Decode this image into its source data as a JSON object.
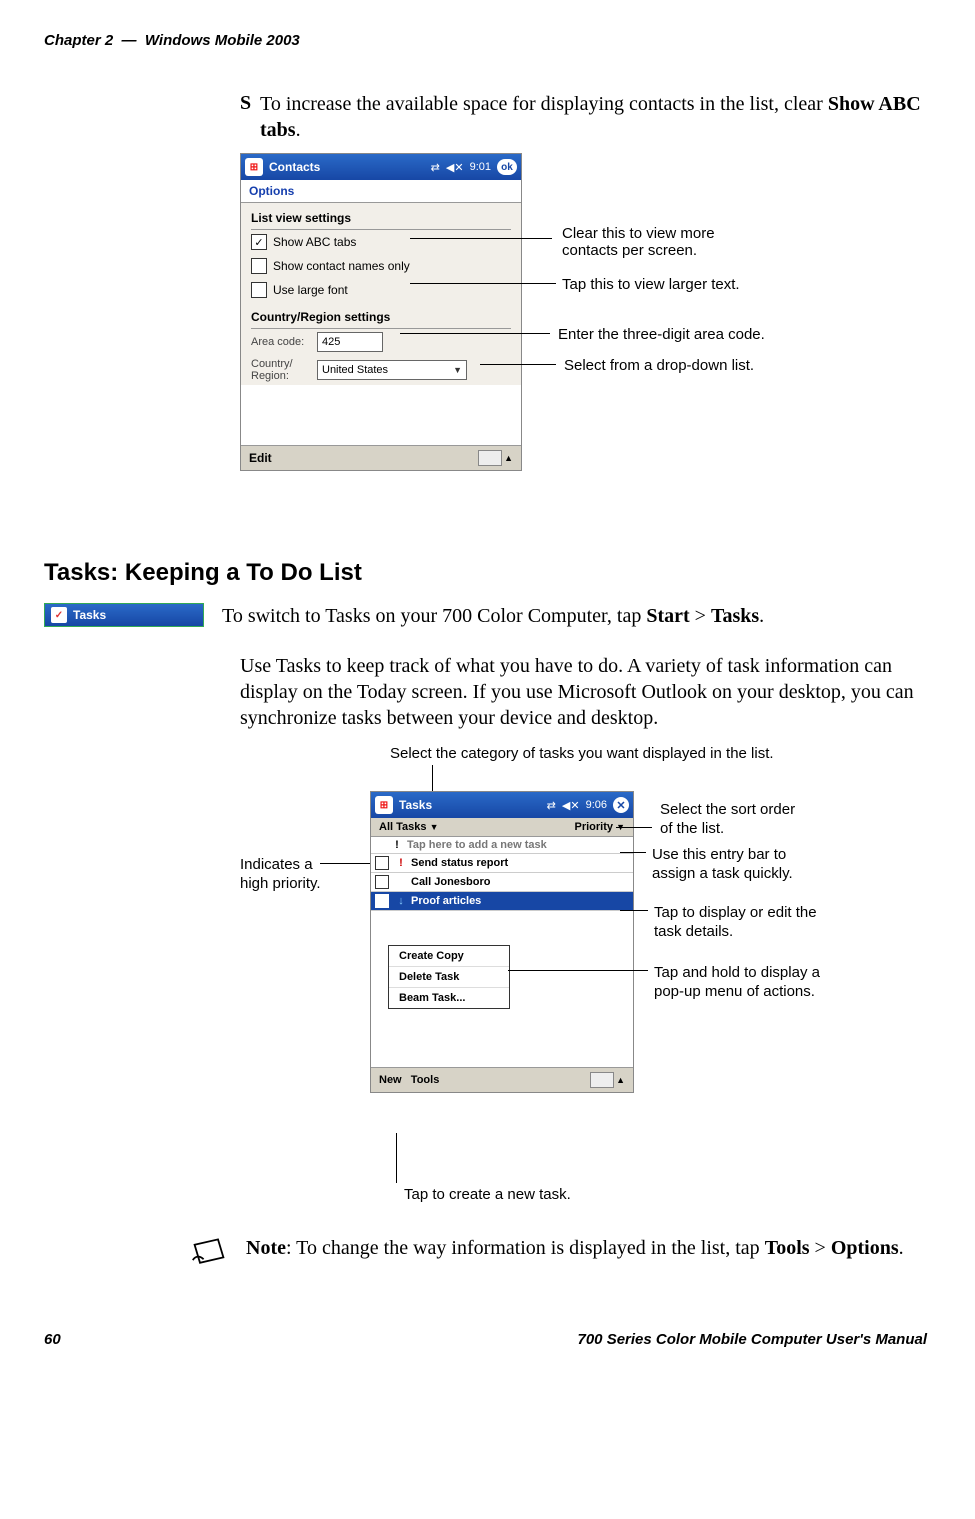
{
  "header": {
    "chapter": "Chapter 2",
    "dash": "—",
    "title": "Windows Mobile 2003"
  },
  "bullet1": {
    "pre": "To increase the available space for displaying contacts in the list, clear ",
    "bold": "Show ABC tabs",
    "post": "."
  },
  "ss1": {
    "app": "Contacts",
    "time": "9:01",
    "ok": "ok",
    "options": "Options",
    "section1": "List view settings",
    "chk1": "Show ABC tabs",
    "chk2": "Show contact names only",
    "chk3": "Use large font",
    "section2": "Country/Region settings",
    "area_label": "Area code:",
    "area_value": "425",
    "country_label": "Country/\nRegion:",
    "country_value": "United States",
    "edit": "Edit"
  },
  "call1": {
    "a": "Clear this to view more",
    "a2": "contacts per screen.",
    "b": "Tap this to view larger text.",
    "c": "Enter the three-digit area code.",
    "d": "Select from a drop-down list."
  },
  "section_heading": "Tasks: Keeping a To Do List",
  "tasks_icon_label": "Tasks",
  "para1": {
    "pre": "To switch to Tasks on your 700 Color Computer, tap ",
    "b1": "Start",
    "gt": " > ",
    "b2": "Tasks",
    "post": "."
  },
  "para2": "Use Tasks to keep track of what you have to do. A variety of task information can display on the Today screen. If you use Microsoft Outlook on your desktop, you can synchronize tasks between your device and desktop.",
  "ss2": {
    "app": "Tasks",
    "time": "9:06",
    "filter_left": "All Tasks",
    "filter_right": "Priority",
    "entry_placeholder": "Tap here to add a new task",
    "rows": [
      {
        "pri": "!",
        "text": "Send status report"
      },
      {
        "pri": "",
        "text": "Call Jonesboro"
      },
      {
        "pri": "↓",
        "text": "Proof articles",
        "selected": true
      }
    ],
    "popup": [
      "Create Copy",
      "Delete Task",
      "Beam Task..."
    ],
    "new": "New",
    "tools": "Tools"
  },
  "call2": {
    "top": "Select the category of tasks you want displayed in the list.",
    "indic1": "Indicates a",
    "indic2": "high priority.",
    "sort1": "Select the sort order",
    "sort2": "of the list.",
    "entry1": "Use this entry bar to",
    "entry2": "assign a task quickly.",
    "disp1": "Tap to display or edit the",
    "disp2": "task details.",
    "hold1": "Tap and hold to display a",
    "hold2": "pop-up menu of actions.",
    "bottom": "Tap to create a new task."
  },
  "note": {
    "b": "Note",
    "text": ": To change the way information is displayed in the list, tap ",
    "b2": "Tools",
    "gt": " > ",
    "b3": "Options",
    "post": "."
  },
  "footer": {
    "page": "60",
    "manual": "700 Series Color Mobile Computer User's Manual"
  }
}
